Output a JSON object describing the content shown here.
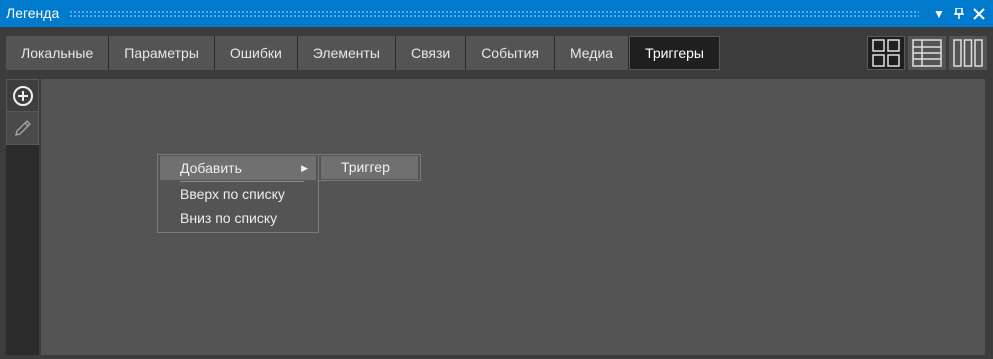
{
  "window": {
    "title": "Легенда",
    "buttons": {
      "dropdown": "▾",
      "pin": "📌",
      "close": "✕"
    }
  },
  "tabs": [
    {
      "label": "Локальные",
      "active": false
    },
    {
      "label": "Параметры",
      "active": false
    },
    {
      "label": "Ошибки",
      "active": false
    },
    {
      "label": "Элементы",
      "active": false
    },
    {
      "label": "Связи",
      "active": false
    },
    {
      "label": "События",
      "active": false
    },
    {
      "label": "Медиа",
      "active": false
    },
    {
      "label": "Триггеры",
      "active": true
    }
  ],
  "view_modes": [
    {
      "icon": "grid-view-icon",
      "active": true
    },
    {
      "icon": "table-view-icon",
      "active": false
    },
    {
      "icon": "columns-view-icon",
      "active": false
    }
  ],
  "sidebar": {
    "add_icon": "plus-circle-icon",
    "edit_icon": "pencil-icon"
  },
  "context_menu": {
    "items": [
      {
        "label": "Добавить",
        "has_submenu": true,
        "highlighted": true
      },
      {
        "label": "Вверх по списку",
        "has_submenu": false,
        "highlighted": false
      },
      {
        "label": "Вниз по списку",
        "has_submenu": false,
        "highlighted": false
      }
    ],
    "submenu": {
      "items": [
        {
          "label": "Триггер",
          "highlighted": true
        }
      ]
    }
  },
  "colors": {
    "titlebar": "#007acc",
    "panel": "#545454",
    "active_tab": "#1f1f1f",
    "frame": "#3c3c3c"
  }
}
